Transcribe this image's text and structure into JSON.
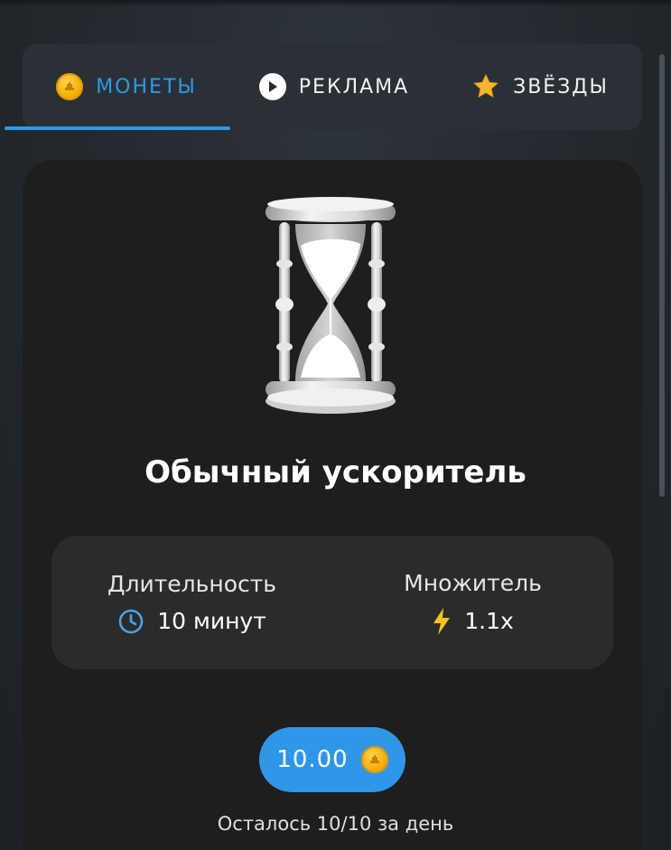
{
  "tabs": [
    {
      "label": "МОНЕТЫ",
      "icon": "coin-icon",
      "active": true
    },
    {
      "label": "РЕКЛАМА",
      "icon": "play-icon",
      "active": false
    },
    {
      "label": "ЗВЁЗДЫ",
      "icon": "star-icon",
      "active": false
    }
  ],
  "booster": {
    "title": "Обычный ускоритель",
    "image_icon": "hourglass-icon",
    "duration": {
      "label": "Длительность",
      "value": "10 минут",
      "icon": "clock-icon"
    },
    "multiplier": {
      "label": "Множитель",
      "value": "1.1x",
      "icon": "lightning-icon"
    }
  },
  "purchase": {
    "price": "10.00",
    "currency_icon": "coin-icon",
    "remaining_text": "Осталось 10/10 за день"
  },
  "colors": {
    "accent": "#2c9ae6",
    "coin": "#f5a700",
    "card_bg": "#1e1e1e",
    "lightning": "#f8c21c"
  }
}
